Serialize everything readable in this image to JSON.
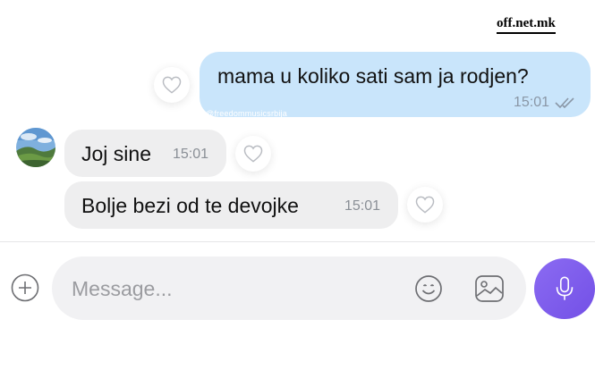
{
  "watermarks": {
    "site": "off.net.mk",
    "handle": "@freedommusicsrbija"
  },
  "conversation": {
    "outgoing": [
      {
        "text": "mama u koliko sati sam ja rodjen?",
        "time": "15:01",
        "status_icon": "double-check-icon"
      }
    ],
    "incoming": [
      {
        "text": "Joj sine",
        "time": "15:01"
      },
      {
        "text": "Bolje bezi od te devojke",
        "time": "15:01"
      }
    ]
  },
  "composer": {
    "placeholder": "Message...",
    "value": "",
    "icons": [
      "plus-icon",
      "emoji-icon",
      "gallery-icon",
      "microphone-icon"
    ]
  },
  "colors": {
    "outgoing_bubble": "#c9e5fb",
    "incoming_bubble": "#eeeeef",
    "mic_button": "#7a5af0"
  }
}
